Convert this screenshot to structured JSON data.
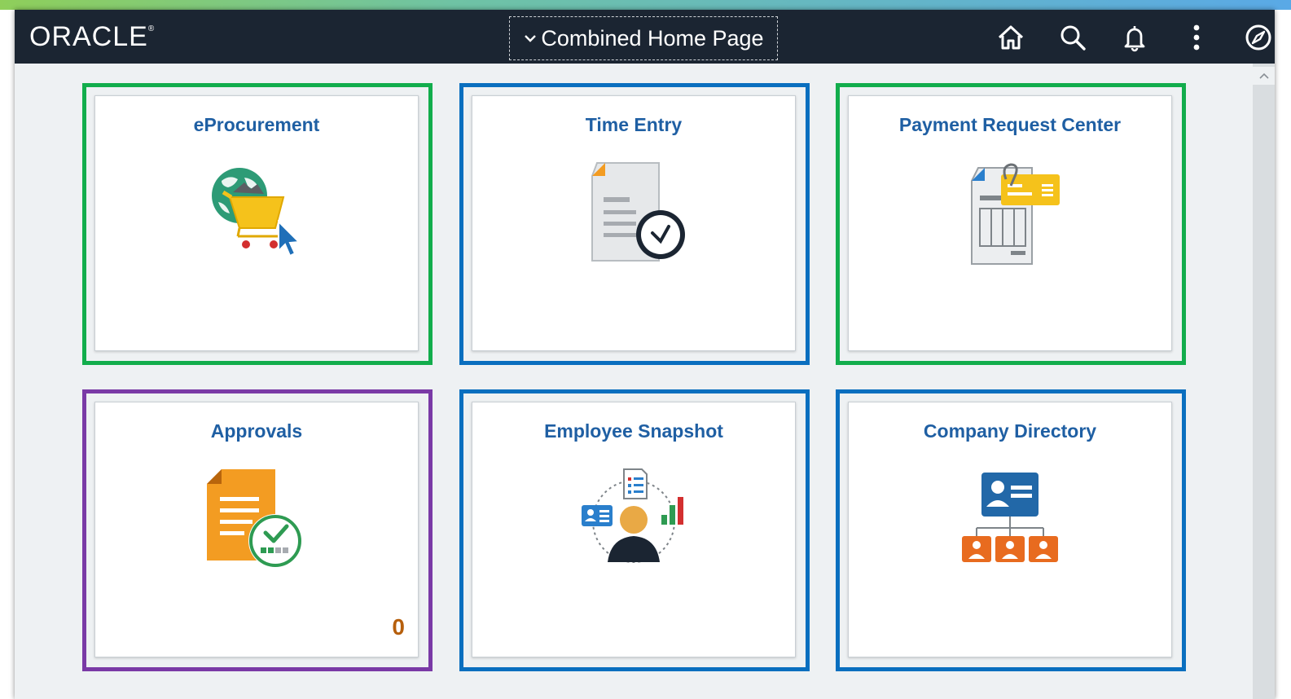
{
  "header": {
    "logo_text": "ORACLE",
    "logo_mark": "®",
    "page_selector_label": "Combined Home Page",
    "icons": [
      "home-icon",
      "search-icon",
      "bell-icon",
      "more-options-icon",
      "navbar-icon"
    ]
  },
  "tiles": [
    {
      "title": "eProcurement",
      "icon": "eprocurement-icon",
      "border_color": "#12ad4c"
    },
    {
      "title": "Time Entry",
      "icon": "time-entry-icon",
      "border_color": "#0a6fbf"
    },
    {
      "title": "Payment Request Center",
      "icon": "payment-request-icon",
      "border_color": "#12ad4c"
    },
    {
      "title": "Approvals",
      "icon": "approvals-icon",
      "border_color": "#7a3aa6",
      "badge": "0"
    },
    {
      "title": "Employee Snapshot",
      "icon": "employee-snapshot-icon",
      "border_color": "#0a6fbf"
    },
    {
      "title": "Company Directory",
      "icon": "company-directory-icon",
      "border_color": "#0a6fbf"
    }
  ],
  "colors": {
    "banner": "#1b2532",
    "tile_title": "#1f5fa3",
    "badge": "#b65f0c",
    "page_background": "#eef1f3"
  }
}
